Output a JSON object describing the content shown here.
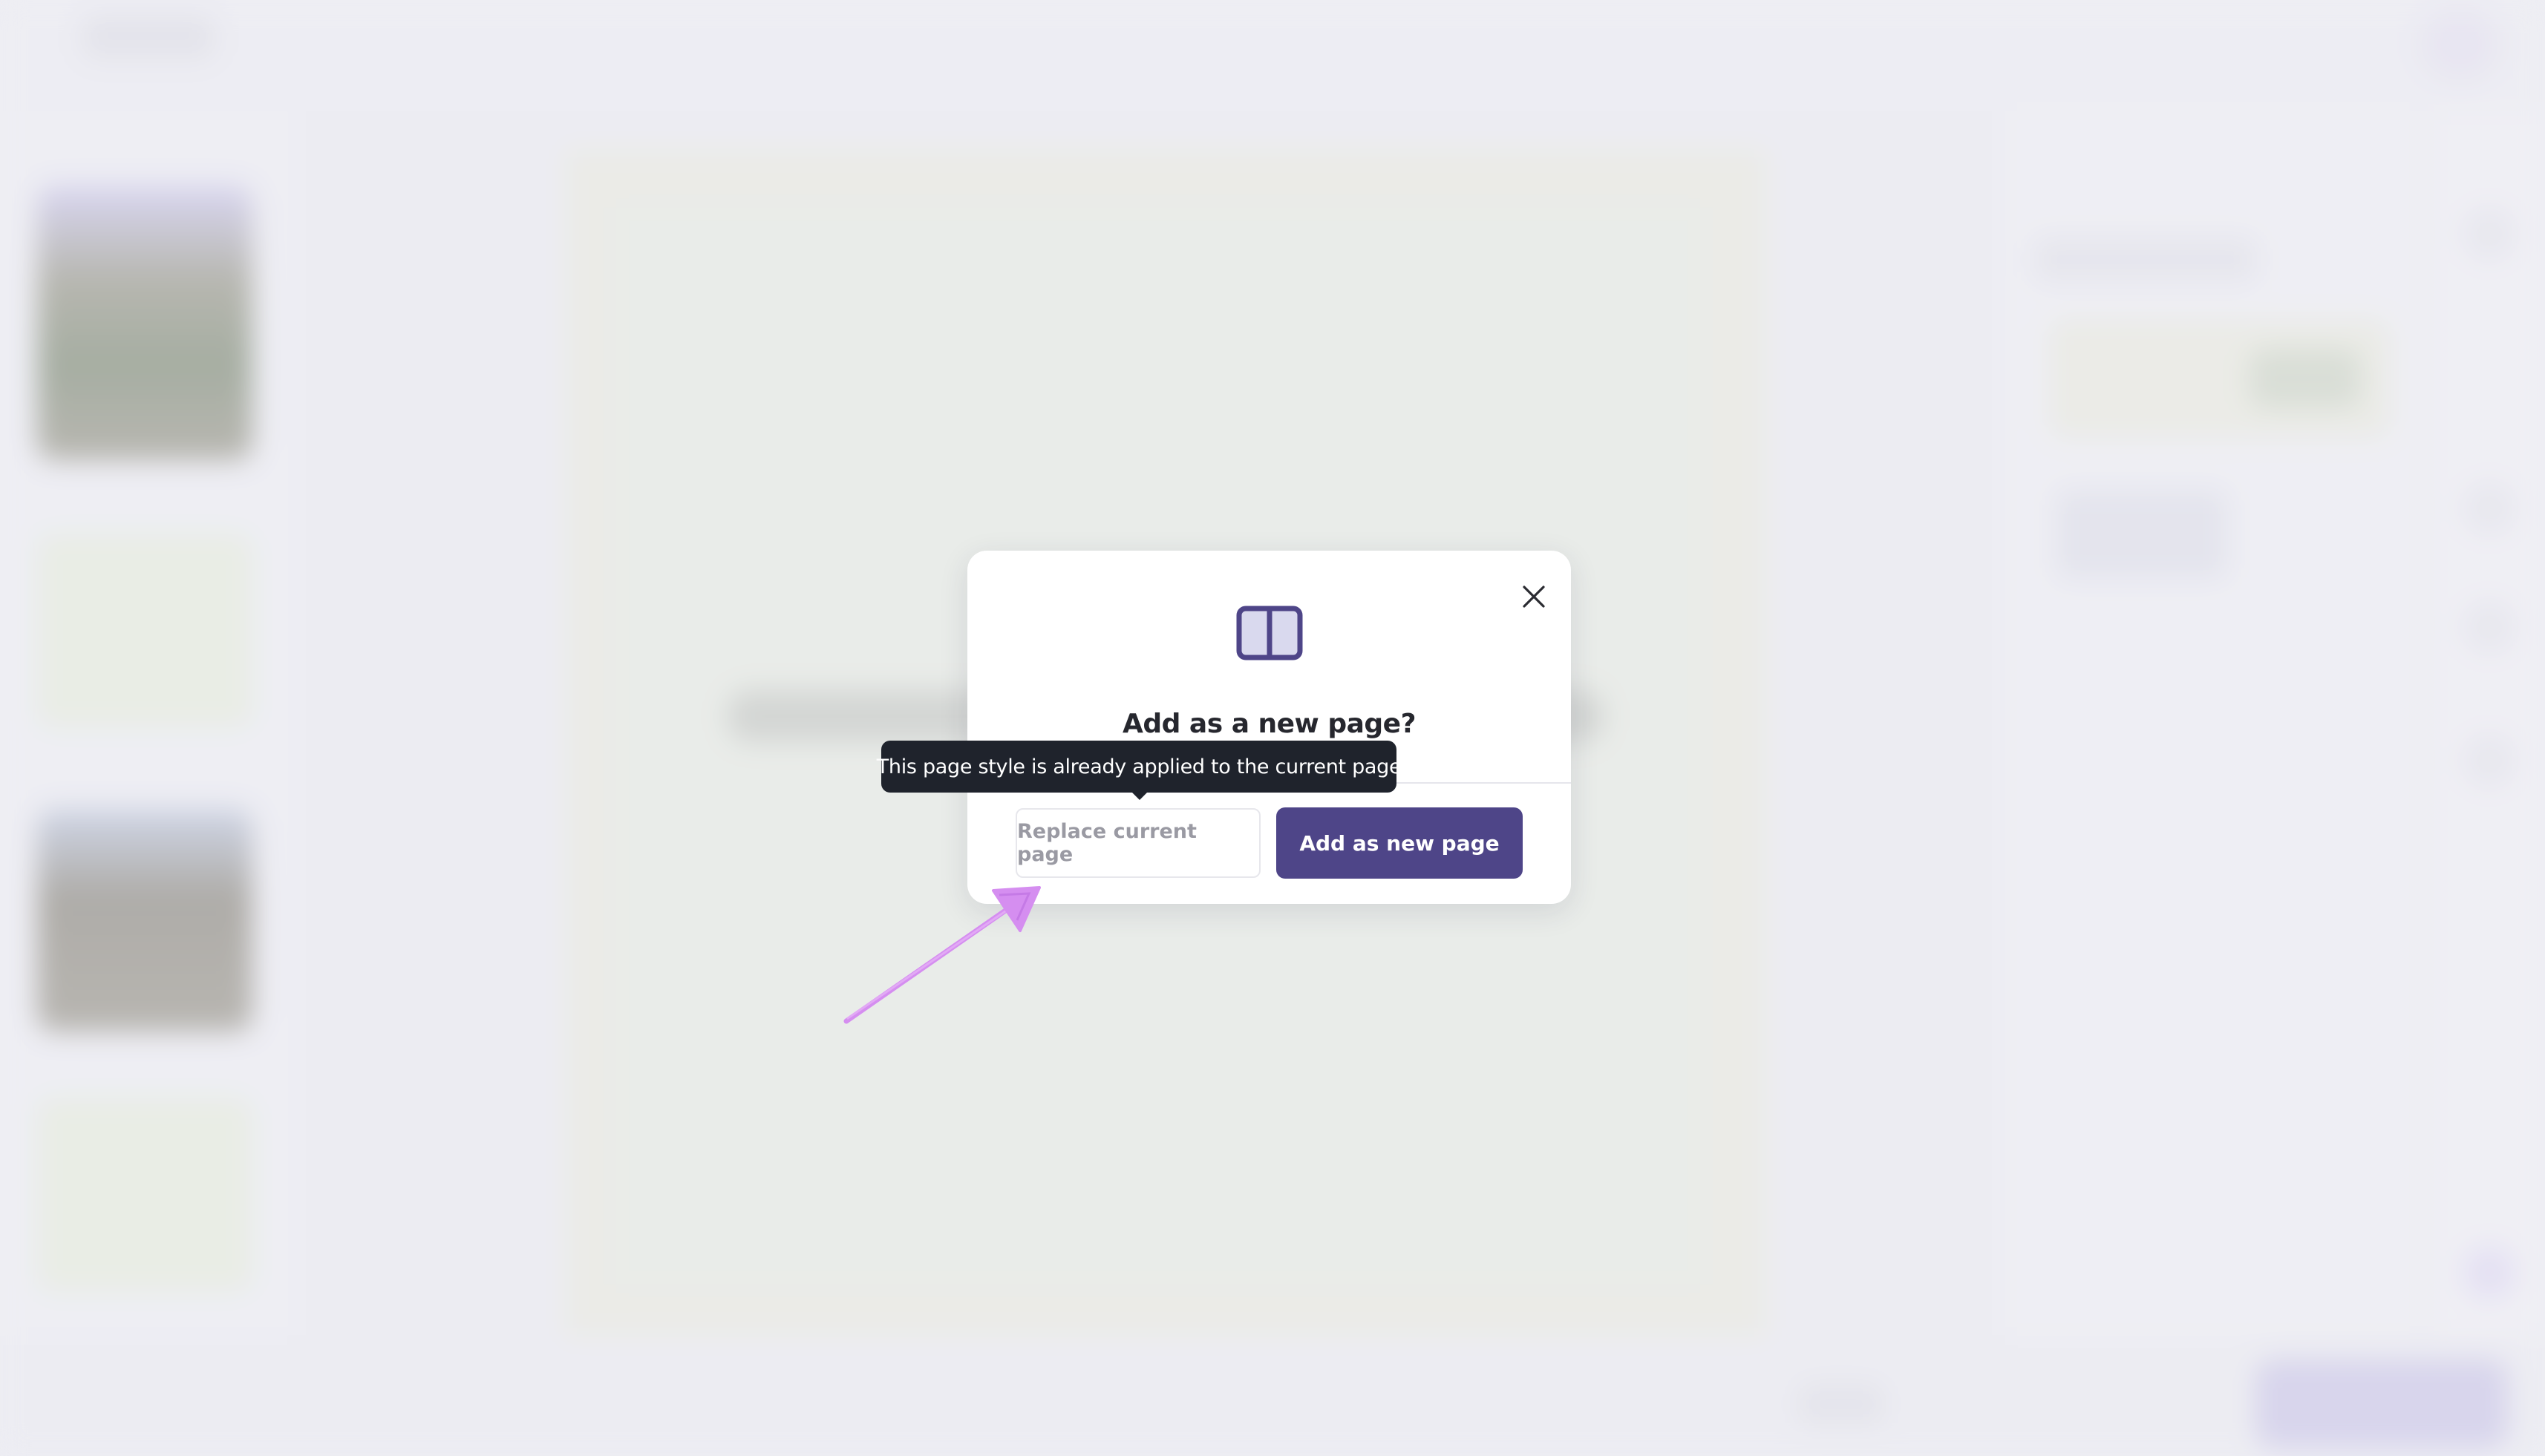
{
  "dialog": {
    "title": "Add as a new page?",
    "icon": "two-column-layout-icon",
    "close_icon": "close-icon"
  },
  "buttons": {
    "replace_label": "Replace current page",
    "add_label": "Add as new page"
  },
  "tooltip": {
    "text": "This page style is already applied to the current page"
  },
  "colors": {
    "primary": "#4e4588",
    "icon_fill": "#d9d9ee",
    "tooltip_bg": "#1f232c",
    "annotation": "#d58ef0"
  }
}
